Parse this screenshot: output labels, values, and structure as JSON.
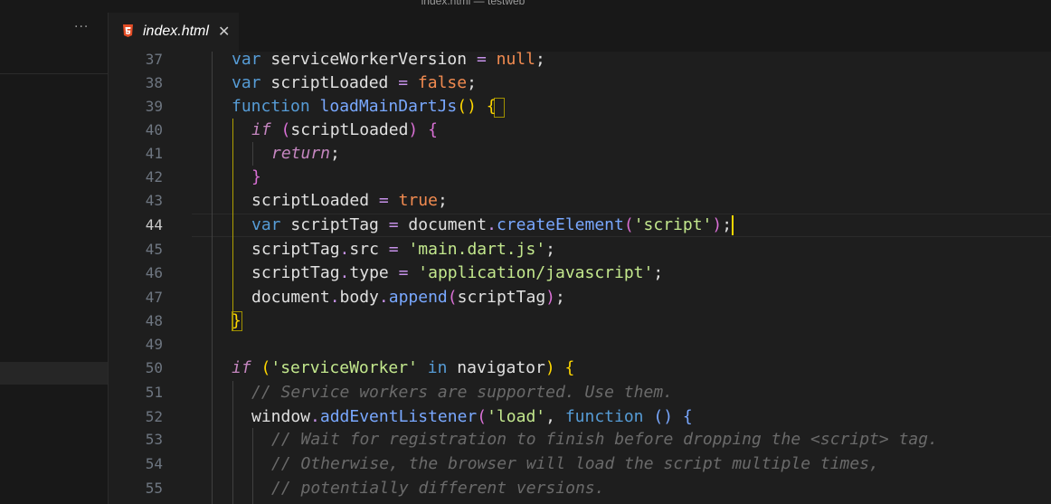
{
  "window": {
    "title": "index.html — testweb"
  },
  "sidebar": {
    "more_label": "···"
  },
  "tab": {
    "label": "index.html",
    "close": "✕",
    "icon": "html5-icon"
  },
  "editor": {
    "line_numbers": [
      "37",
      "38",
      "39",
      "40",
      "41",
      "42",
      "43",
      "44",
      "45",
      "46",
      "47",
      "48",
      "49",
      "50",
      "51",
      "52",
      "53",
      "54",
      "55"
    ],
    "active_line": "44",
    "lines": {
      "l37": {
        "a": "var",
        "b": " serviceWorkerVersion ",
        "c": "=",
        "d": " ",
        "e": "null",
        "f": ";"
      },
      "l38": {
        "a": "var",
        "b": " scriptLoaded ",
        "c": "=",
        "d": " ",
        "e": "false",
        "f": ";"
      },
      "l39": {
        "a": "function",
        "b": " ",
        "c": "loadMainDartJs",
        "d": "()",
        "e": " ",
        "f": "{"
      },
      "l40": {
        "a": "if",
        "b": " ",
        "c": "(",
        "d": "scriptLoaded",
        "e": ")",
        "f": " {"
      },
      "l41": {
        "a": "return",
        "b": ";"
      },
      "l42": {
        "a": "}"
      },
      "l43": {
        "a": "scriptLoaded ",
        "b": "=",
        "c": " ",
        "d": "true",
        "e": ";"
      },
      "l44": {
        "a": "var",
        "b": " scriptTag ",
        "c": "=",
        "d": " document",
        "e": ".",
        "f": "createElement",
        "g": "(",
        "h": "'script'",
        "i": ")",
        "j": ";"
      },
      "l45": {
        "a": "scriptTag",
        "b": ".",
        "c": "src ",
        "d": "=",
        "e": " ",
        "f": "'main.dart.js'",
        "g": ";"
      },
      "l46": {
        "a": "scriptTag",
        "b": ".",
        "c": "type ",
        "d": "=",
        "e": " ",
        "f": "'application/javascript'",
        "g": ";"
      },
      "l47": {
        "a": "document",
        "b": ".",
        "c": "body",
        "d": ".",
        "e": "append",
        "f": "(",
        "g": "scriptTag",
        "h": ")",
        "i": ";"
      },
      "l48": {
        "a": "}"
      },
      "l50": {
        "a": "if",
        "b": " ",
        "c": "(",
        "d": "'serviceWorker'",
        "e": " ",
        "f": "in",
        "g": " navigator",
        "h": ")",
        "i": " ",
        "j": "{"
      },
      "l51": {
        "a": "// Service workers are supported. Use them."
      },
      "l52": {
        "a": "window",
        "b": ".",
        "c": "addEventListener",
        "d": "(",
        "e": "'load'",
        "f": ", ",
        "g": "function",
        "h": " ",
        "i": "()",
        "j": " ",
        "k": "{"
      },
      "l53": {
        "a": "// Wait for registration to finish before dropping the <script> tag."
      },
      "l54": {
        "a": "// Otherwise, the browser will load the script multiple times,"
      },
      "l55": {
        "a": "// potentially different versions."
      }
    }
  }
}
